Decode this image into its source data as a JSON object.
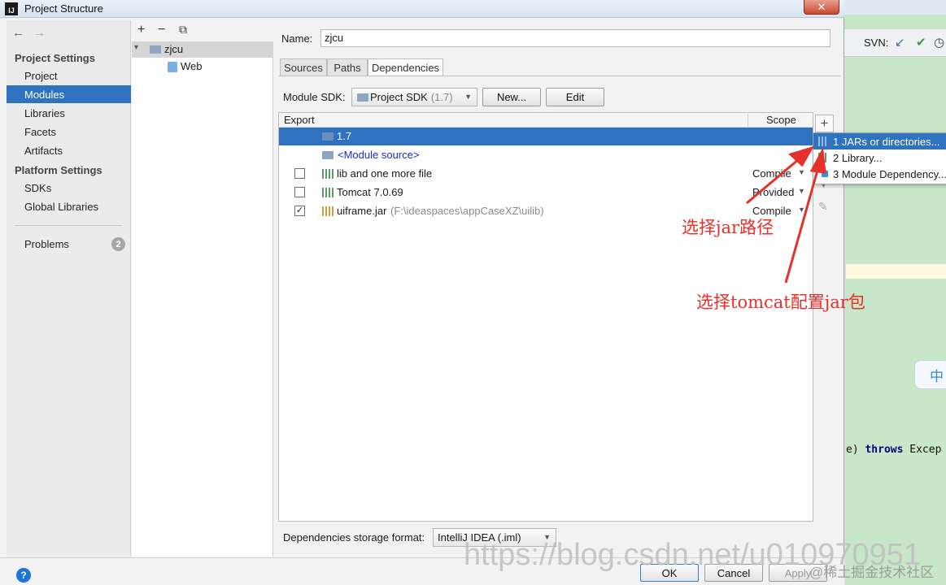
{
  "window": {
    "title": "Project Structure",
    "close_label": "✕"
  },
  "ide": {
    "svn_label": "SVN:",
    "code_snippet_pre": "e) ",
    "code_keyword": "throws",
    "code_snippet_post": " Excep",
    "bubble_text": "中"
  },
  "nav": {
    "back_arrow": "←",
    "forward_arrow": "→",
    "project_settings_header": "Project Settings",
    "project_settings": [
      "Project",
      "Modules",
      "Libraries",
      "Facets",
      "Artifacts"
    ],
    "platform_settings_header": "Platform Settings",
    "platform_settings": [
      "SDKs",
      "Global Libraries"
    ],
    "problems_label": "Problems",
    "problems_count": "2"
  },
  "tree": {
    "toolbar": [
      "+",
      "−",
      "⧉"
    ],
    "module_name": "zjcu",
    "facet_name": "Web"
  },
  "module": {
    "name_label": "Name:",
    "name_value": "zjcu",
    "tabs": [
      "Sources",
      "Paths",
      "Dependencies"
    ],
    "active_tab": "Dependencies",
    "sdk_label": "Module SDK:",
    "sdk_value": "Project SDK",
    "sdk_hint": "(1.7)",
    "new_button": "New...",
    "edit_button": "Edit",
    "storage_label": "Dependencies storage format:",
    "storage_value": "IntelliJ IDEA (.iml)"
  },
  "deps": {
    "header_export": "Export",
    "header_scope": "Scope",
    "rows": [
      {
        "name": "1.7",
        "path": "",
        "scope": "",
        "checked": false,
        "selected": true
      },
      {
        "name": "<Module source>",
        "path": "",
        "scope": "",
        "checked": false,
        "selected": false
      },
      {
        "name": "lib and one more file",
        "path": "",
        "scope": "Compile",
        "checked": false,
        "selected": false
      },
      {
        "name": "Tomcat 7.0.69",
        "path": "",
        "scope": "Provided",
        "checked": false,
        "selected": false
      },
      {
        "name": "uiframe.jar",
        "path": "(F:\\ideaspaces\\appCaseXZ\\uilib)",
        "scope": "Compile",
        "checked": true,
        "selected": false
      }
    ],
    "add_button": "+"
  },
  "popup": {
    "items": [
      {
        "label": "1  JARs or directories...",
        "icon": "jar-icon"
      },
      {
        "label": "2  Library...",
        "icon": "library-icon"
      },
      {
        "label": "3  Module Dependency...",
        "icon": "module-icon"
      }
    ]
  },
  "annotations": {
    "jar_path": "选择jar路径",
    "tomcat_jar": "选择tomcat配置jar包"
  },
  "buttons": {
    "help": "?",
    "ok": "OK",
    "cancel": "Cancel",
    "apply": "Apply"
  },
  "watermarks": {
    "url": "https://blog.csdn.net/u010970951",
    "juejin": "@稀土掘金技术社区"
  },
  "colors": {
    "selection": "#2f72c0",
    "annotation": "#e8302a"
  }
}
